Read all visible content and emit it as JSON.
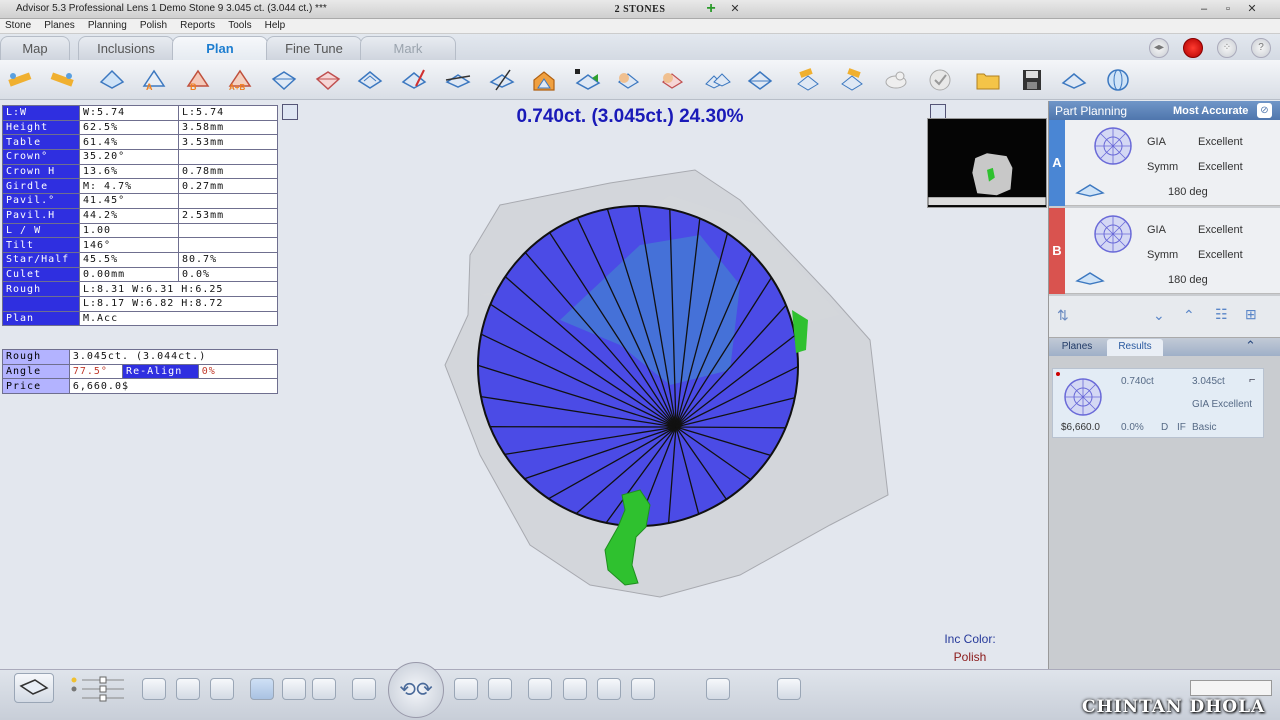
{
  "window": {
    "title": "Advisor 5.3 Professional Lens 1     Demo Stone 9   3.045 ct. (3.044 ct.) ***",
    "center_label": "2 STONES"
  },
  "menu": [
    "Stone",
    "Planes",
    "Planning",
    "Polish",
    "Reports",
    "Tools",
    "Help"
  ],
  "tabs": [
    {
      "label": "Map",
      "state": "normal"
    },
    {
      "label": "Inclusions",
      "state": "normal"
    },
    {
      "label": "Plan",
      "state": "active"
    },
    {
      "label": "Fine Tune",
      "state": "normal"
    },
    {
      "label": "Mark",
      "state": "disabled"
    }
  ],
  "params": [
    {
      "label": "L:W",
      "v1": "W:5.74",
      "v2": "L:5.74"
    },
    {
      "label": "Height",
      "v1": "62.5%",
      "v2": "3.58mm"
    },
    {
      "label": "Table",
      "v1": "61.4%",
      "v2": "3.53mm"
    },
    {
      "label": "Crown°",
      "v1": "35.20°",
      "v2": ""
    },
    {
      "label": "Crown H",
      "v1": "13.6%",
      "v2": "0.78mm"
    },
    {
      "label": "Girdle",
      "v1": "M: 4.7%",
      "v2": "0.27mm"
    },
    {
      "label": "Pavil.°",
      "v1": "41.45°",
      "v2": ""
    },
    {
      "label": "Pavil.H",
      "v1": "44.2%",
      "v2": "2.53mm"
    },
    {
      "label": "L / W",
      "v1": "1.00",
      "v2": ""
    },
    {
      "label": "Tilt",
      "v1": "146°",
      "v2": ""
    },
    {
      "label": "Star/Half",
      "v1": "45.5%",
      "v2": "80.7%"
    },
    {
      "label": "Culet",
      "v1": "0.00mm",
      "v2": "0.0%"
    },
    {
      "label": "Rough",
      "v1": "L:8.31 W:6.31 H:6.25",
      "v2": ""
    },
    {
      "label": "",
      "v1": "L:8.17 W:6.82 H:8.72",
      "v2": ""
    },
    {
      "label": "Plan",
      "v1": "M.Acc",
      "v2": ""
    }
  ],
  "summary": {
    "rough_label": "Rough",
    "rough_value": "3.045ct. (3.044ct.)",
    "angle_label": "Angle",
    "angle_value": "77.5°",
    "realign_label": "Re-Align",
    "realign_value": "0%",
    "price_label": "Price",
    "price_value": "6,660.0$"
  },
  "headline": "0.740ct. (3.045ct.) 24.30%",
  "inc": {
    "label": "Inc Color:",
    "value": "Polish"
  },
  "right_panel": {
    "title": "Part Planning",
    "mode": "Most Accurate",
    "plans": [
      {
        "letter": "A",
        "color": "#4a86d4",
        "lab": "GIA",
        "cut": "Excellent",
        "symm_label": "Symm",
        "symm": "Excellent",
        "deg": "180 deg"
      },
      {
        "letter": "B",
        "color": "#d9534f",
        "lab": "GIA",
        "cut": "Excellent",
        "symm_label": "Symm",
        "symm": "Excellent",
        "deg": "180 deg"
      }
    ],
    "tab_planes": "Planes",
    "tab_results": "Results",
    "result": {
      "ct": "0.740ct",
      "rough_ct": "3.045ct",
      "grade": "GIA Excellent",
      "price": "$6,660.0",
      "pct": "0.0%",
      "color": "D",
      "clarity": "IF",
      "type": "Basic"
    }
  },
  "watermark": "CHINTAN DHOLA",
  "icons": [
    "rotate-icon",
    "refresh-icon",
    "ruler-icon",
    "cut-plan-icon",
    "folder-icon",
    "save-icon",
    "cloud-icon",
    "globe-icon",
    "stop-icon",
    "grid-icon",
    "help-icon"
  ],
  "colors": {
    "accent": "#1d7ed0",
    "label_bg": "#2f2fe0",
    "stone_blue": "#4b4be6",
    "inclusion_green": "#2fc12f"
  }
}
